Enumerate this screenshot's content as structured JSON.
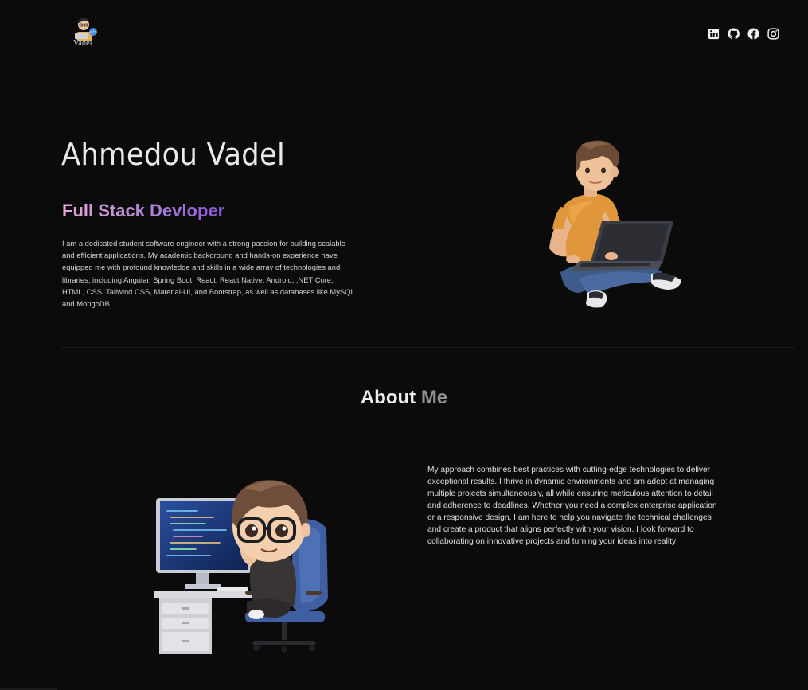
{
  "header": {
    "logo_text": "Vadel",
    "socials": [
      {
        "name": "linkedin-icon"
      },
      {
        "name": "github-icon"
      },
      {
        "name": "facebook-icon"
      },
      {
        "name": "instagram-icon"
      }
    ]
  },
  "hero": {
    "name": "Ahmedou Vadel",
    "role": "Full Stack Devloper",
    "description": "I am a dedicated student software engineer with a strong passion for building scalable and efficient applications. My academic background and hands-on experience have equipped me with profound knowledge and skills in a wide array of technologies and libraries, including Angular, Spring Boot, React, React Native, Android, .NET Core, HTML, CSS, Tailwind CSS, Material-UI, and Bootstrap, as well as databases like MySQL and MongoDB."
  },
  "about": {
    "title_first": "About",
    "title_second": "Me",
    "description": "My approach combines best practices with cutting-edge technologies to deliver exceptional results. I thrive in dynamic environments and am adept at managing multiple projects simultaneously, all while ensuring meticulous attention to detail and adherence to deadlines. Whether you need a complex enterprise application or a responsive design, I am here to help you navigate the technical challenges and create a product that aligns perfectly with your vision. I look forward to collaborating on innovative projects and turning your ideas into reality!"
  },
  "colors": {
    "background": "#0b0b0c",
    "gradient_start": "#e9a8d8",
    "gradient_end": "#8a56d8",
    "muted": "#8e8e93"
  }
}
